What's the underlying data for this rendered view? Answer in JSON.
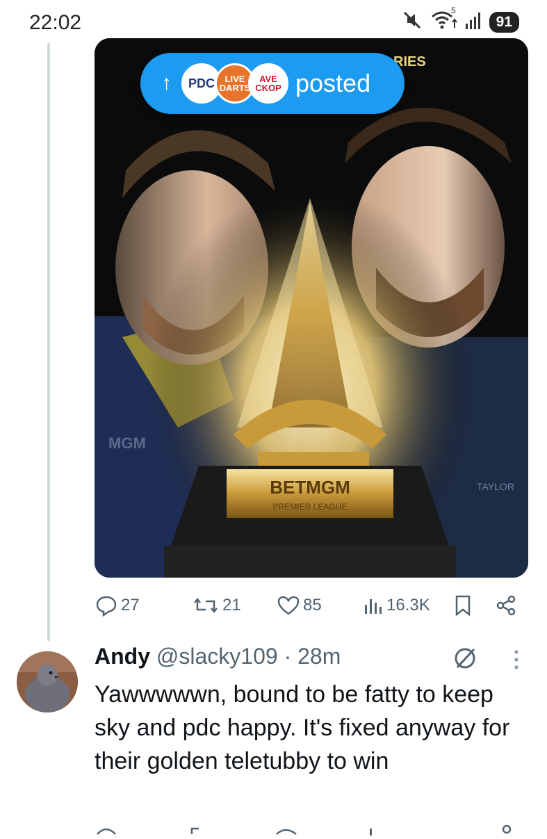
{
  "status_bar": {
    "time": "22:02",
    "battery": "91",
    "wifi_label": "5",
    "icons": [
      "mute-icon",
      "wifi-icon",
      "signal-icon"
    ]
  },
  "media": {
    "overlay_text_top": "RIES",
    "trophy_brand": "BETMGM",
    "trophy_subtitle": "PREMIER LEAGUE",
    "left_shirt_text": "MGM",
    "right_shirt_text": "TAYLOR"
  },
  "posted_pill": {
    "label": "posted",
    "avatars": [
      {
        "name": "PDC",
        "text": "PDC"
      },
      {
        "name": "Live Darts",
        "text": "LIVE DARTS"
      },
      {
        "name": "Save Checkout",
        "text": "AVE CKOP"
      }
    ]
  },
  "actions": {
    "replies": "27",
    "reposts": "21",
    "likes": "85",
    "views": "16.3K"
  },
  "reply": {
    "name": "Andy",
    "handle": "@slacky109 · 28m",
    "text": "Yawwwwwn, bound to be fatty to keep sky and pdc happy.  It's fixed anyway for their golden teletubby to win"
  },
  "colors": {
    "accent": "#1d9bf0",
    "muted": "#536471",
    "text": "#0f1419",
    "thread_line": "#cfd9de"
  }
}
